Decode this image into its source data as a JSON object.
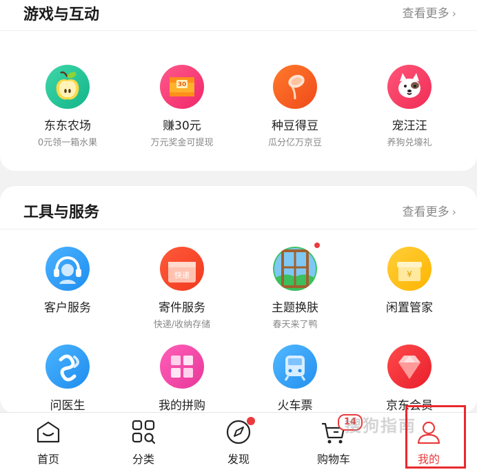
{
  "games": {
    "title": "游戏与互动",
    "more": "查看更多",
    "items": [
      {
        "label": "东东农场",
        "sub": "0元领一箱水果",
        "icon": "apple-icon"
      },
      {
        "label": "赚30元",
        "sub": "万元奖金可提现",
        "icon": "treasure-chest-icon"
      },
      {
        "label": "种豆得豆",
        "sub": "瓜分亿万京豆",
        "icon": "bean-sprout-icon"
      },
      {
        "label": "宠汪汪",
        "sub": "养狗兑壕礼",
        "icon": "dog-face-icon"
      }
    ]
  },
  "tools": {
    "title": "工具与服务",
    "more": "查看更多",
    "items": [
      {
        "label": "客户服务",
        "sub": "",
        "icon": "customer-service-icon"
      },
      {
        "label": "寄件服务",
        "sub": "快递/收纳存储",
        "icon": "parcel-box-icon",
        "badge_text": "快递"
      },
      {
        "label": "主题换肤",
        "sub": "春天来了鸭",
        "icon": "window-landscape-icon"
      },
      {
        "label": "闲置管家",
        "sub": "",
        "icon": "gift-box-icon",
        "badge_text": "¥"
      },
      {
        "label": "问医生",
        "sub": "",
        "icon": "medical-knot-icon"
      },
      {
        "label": "我的拼购",
        "sub": "",
        "icon": "puzzle-icon"
      },
      {
        "label": "火车票",
        "sub": "",
        "icon": "train-icon"
      },
      {
        "label": "京东会员",
        "sub": "",
        "icon": "diamond-icon"
      }
    ]
  },
  "nav": {
    "items": [
      {
        "label": "首页",
        "icon": "home-icon"
      },
      {
        "label": "分类",
        "icon": "category-grid-icon"
      },
      {
        "label": "发现",
        "icon": "compass-icon"
      },
      {
        "label": "购物车",
        "icon": "cart-icon",
        "badge": "14"
      },
      {
        "label": "我的",
        "icon": "user-icon",
        "active": true
      }
    ]
  },
  "watermark": "搜狗指南",
  "colors": {
    "accent": "#e93b3d",
    "highlight": "#e8282c"
  }
}
